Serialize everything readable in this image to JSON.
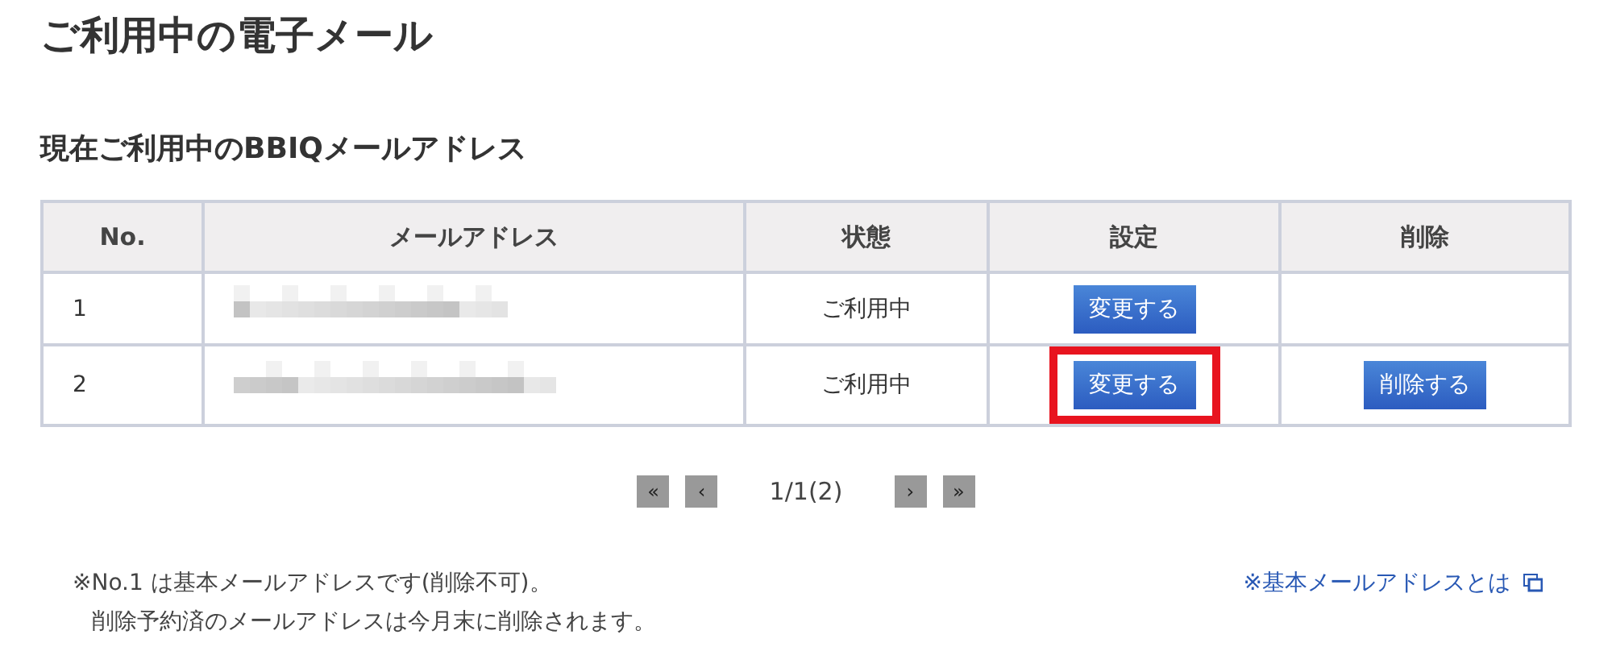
{
  "page_title": "ご利用中の電子メール",
  "section_title": "現在ご利用中のBBIQメールアドレス",
  "table": {
    "columns": [
      "No.",
      "メールアドレス",
      "状態",
      "設定",
      "削除"
    ],
    "rows": [
      {
        "no": "1",
        "address_blurred": true,
        "status": "ご利用中",
        "change_button": {
          "label": "変更する",
          "highlighted": false
        }
      },
      {
        "no": "2",
        "address_blurred": true,
        "status": "ご利用中",
        "change_button": {
          "label": "変更する",
          "highlighted": true
        },
        "delete_button": "削除する"
      }
    ]
  },
  "pagination": {
    "first": "«",
    "prev": "‹",
    "page": "1/1(2)",
    "next": "›",
    "last": "»"
  },
  "notes": [
    "※No.1 は基本メールアドレスです(削除不可)。",
    "削除予約済のメールアドレスは今月末に削除されます。"
  ],
  "help_link": "※基本メールアドレスとは"
}
